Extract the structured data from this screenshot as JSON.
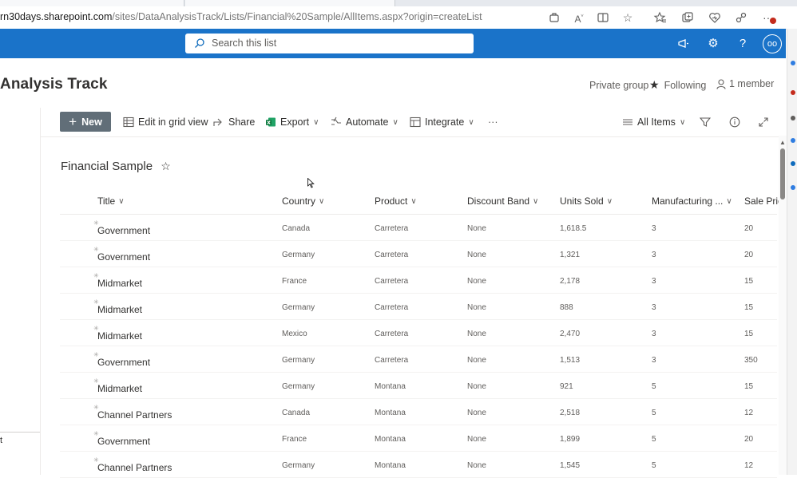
{
  "browser": {
    "url_host": "rn30days.sharepoint.com",
    "url_path": "/sites/DataAnalysisTrack/Lists/Financial%20Sample/AllItems.aspx?origin=createList",
    "icons": [
      "extensions-icon",
      "read-aloud-icon",
      "split-screen-icon",
      "favorite-star-icon",
      "favorites-icon",
      "collections-icon",
      "browser-essentials-icon",
      "share-icon",
      "more-icon"
    ]
  },
  "suite_bar": {
    "search_placeholder": "Search this list",
    "icons": [
      "megaphone-icon",
      "settings-icon",
      "help-icon"
    ],
    "avatar_initials": "oo",
    "color": "#1a73c9"
  },
  "site": {
    "title": "Analysis Track",
    "private_group": "Private group",
    "following": "Following",
    "members": "1 member"
  },
  "left_nav": {
    "bottom_text": "t"
  },
  "command_bar": {
    "new_label": "New",
    "edit_grid": "Edit in grid view",
    "share": "Share",
    "export": "Export",
    "automate": "Automate",
    "integrate": "Integrate",
    "more": "···",
    "view_name": "All Items"
  },
  "list": {
    "title": "Financial Sample",
    "columns": [
      "Title",
      "Country",
      "Product",
      "Discount Band",
      "Units Sold",
      "Manufacturing ...",
      "Sale Pric"
    ],
    "rows": [
      {
        "title": "Government",
        "country": "Canada",
        "product": "Carretera",
        "discount": "None",
        "units": "1,618.5",
        "mfg": "3",
        "sale": "20"
      },
      {
        "title": "Government",
        "country": "Germany",
        "product": "Carretera",
        "discount": "None",
        "units": "1,321",
        "mfg": "3",
        "sale": "20"
      },
      {
        "title": "Midmarket",
        "country": "France",
        "product": "Carretera",
        "discount": "None",
        "units": "2,178",
        "mfg": "3",
        "sale": "15"
      },
      {
        "title": "Midmarket",
        "country": "Germany",
        "product": "Carretera",
        "discount": "None",
        "units": "888",
        "mfg": "3",
        "sale": "15"
      },
      {
        "title": "Midmarket",
        "country": "Mexico",
        "product": "Carretera",
        "discount": "None",
        "units": "2,470",
        "mfg": "3",
        "sale": "15"
      },
      {
        "title": "Government",
        "country": "Germany",
        "product": "Carretera",
        "discount": "None",
        "units": "1,513",
        "mfg": "3",
        "sale": "350"
      },
      {
        "title": "Midmarket",
        "country": "Germany",
        "product": "Montana",
        "discount": "None",
        "units": "921",
        "mfg": "5",
        "sale": "15"
      },
      {
        "title": "Channel Partners",
        "country": "Canada",
        "product": "Montana",
        "discount": "None",
        "units": "2,518",
        "mfg": "5",
        "sale": "12"
      },
      {
        "title": "Government",
        "country": "France",
        "product": "Montana",
        "discount": "None",
        "units": "1,899",
        "mfg": "5",
        "sale": "20"
      },
      {
        "title": "Channel Partners",
        "country": "Germany",
        "product": "Montana",
        "discount": "None",
        "units": "1,545",
        "mfg": "5",
        "sale": "12"
      }
    ]
  }
}
